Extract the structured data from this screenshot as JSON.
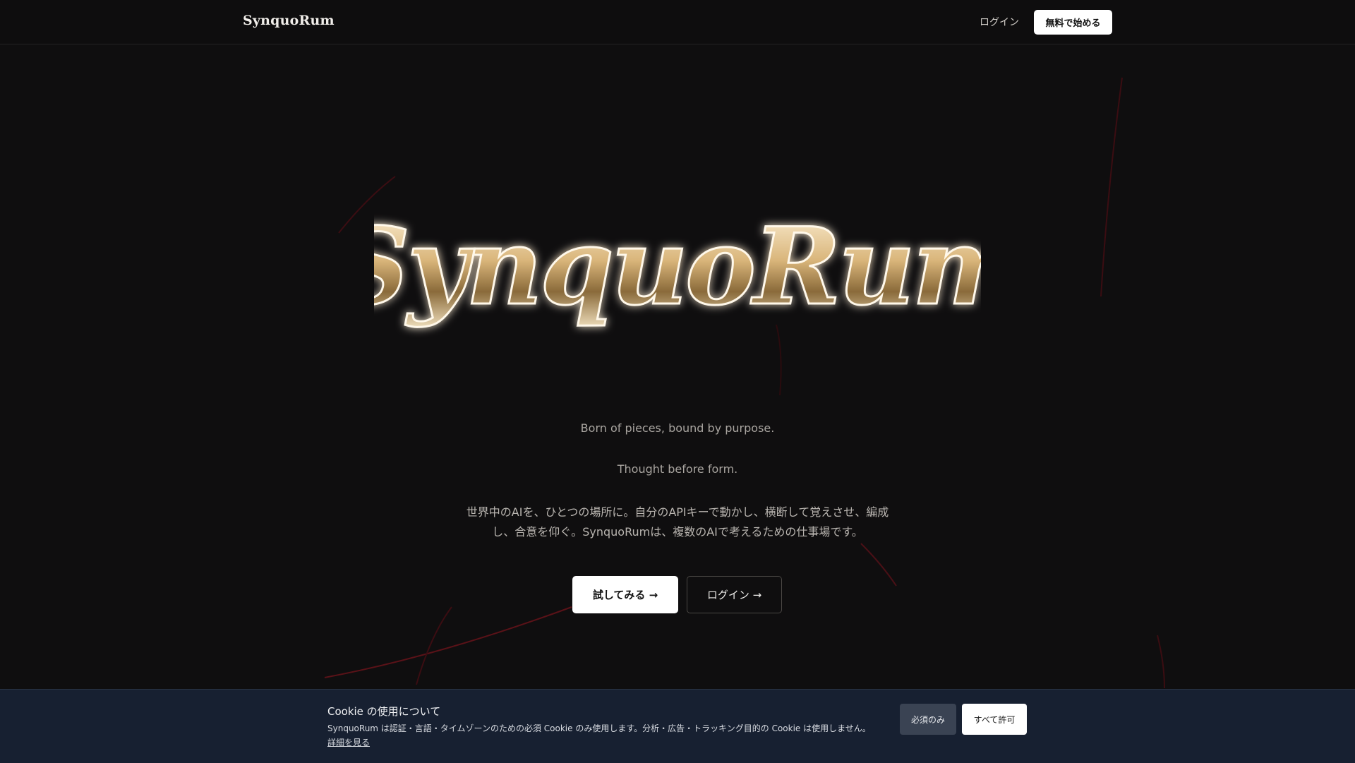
{
  "header": {
    "brand": "SynquoRum",
    "login_label": "ログイン",
    "cta_label": "無料で始める"
  },
  "hero": {
    "logo_text": "SynquoRum",
    "tagline_1": "Born of pieces, bound by purpose.",
    "tagline_2": "Thought before form.",
    "description_line_1": "世界中のAIを、ひとつの場所に。自分のAPIキーで動かし、横断して覚えさせ、編成",
    "description_line_2": "し、合意を仰ぐ。SynquoRumは、複数のAIで考えるための仕事場です。",
    "primary_button": "試してみる →",
    "secondary_button": "ログイン →"
  },
  "cookie_banner": {
    "title": "Cookie の使用について",
    "text": "SynquoRum は認証・言語・タイムゾーンのための必須 Cookie のみ使用します。分析・広告・トラッキング目的の Cookie は使用しません。",
    "details_link": "詳細を見る",
    "essential_button": "必須のみ",
    "allow_all_button": "すべて許可"
  },
  "colors": {
    "background": "#0f0e0f",
    "accent_line": "#5a1218",
    "logo_gold": "#c9a46a",
    "cookie_bg": "#172031"
  }
}
